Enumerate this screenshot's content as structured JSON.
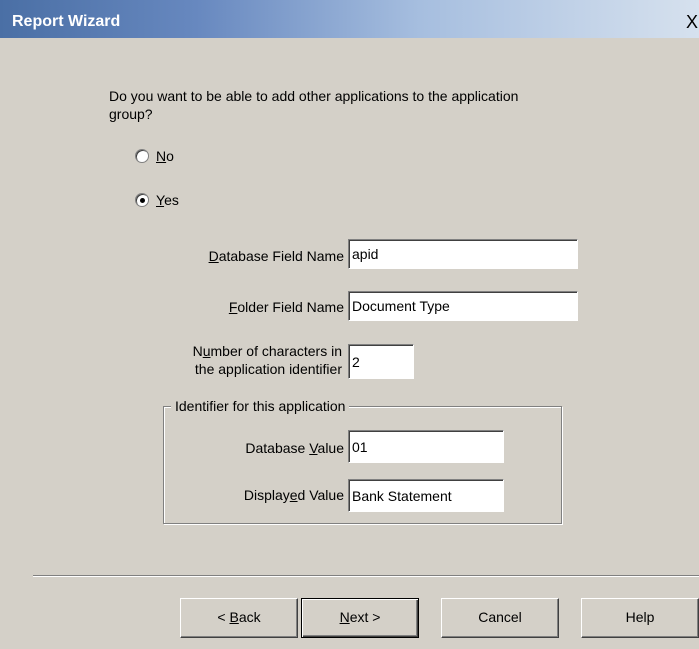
{
  "window": {
    "title": "Report Wizard",
    "close_glyph": "X"
  },
  "question": "Do you want to be able to add other applications to the application group?",
  "options": {
    "no": {
      "label": "No",
      "mnemonic": "N",
      "rest": "o",
      "selected": false
    },
    "yes": {
      "label": "Yes",
      "mnemonic": "Y",
      "rest": "es",
      "selected": true
    }
  },
  "fields": {
    "db_field_name": {
      "pre": "",
      "mnemonic": "D",
      "post": "atabase Field Name",
      "value": "apid"
    },
    "folder_field_name": {
      "pre": "",
      "mnemonic": "F",
      "post": "older Field Name",
      "value": "Document Type"
    },
    "num_chars": {
      "line1_pre": "N",
      "line1_mnemonic": "u",
      "line1_post": "mber of characters in",
      "line2": "the application identifier",
      "value": "2"
    }
  },
  "identifier_group": {
    "title": "Identifier for this application",
    "database_value": {
      "pre": "Database ",
      "mnemonic": "V",
      "post": "alue",
      "value": "01"
    },
    "displayed_value": {
      "pre": "Display",
      "mnemonic": "e",
      "post": "d Value",
      "value": "Bank Statement"
    }
  },
  "buttons": {
    "back": {
      "pre": "< ",
      "mnemonic": "B",
      "post": "ack"
    },
    "next": {
      "pre": "",
      "mnemonic": "N",
      "post": "ext >"
    },
    "cancel": {
      "label": "Cancel"
    },
    "help": {
      "label": "Help"
    }
  }
}
